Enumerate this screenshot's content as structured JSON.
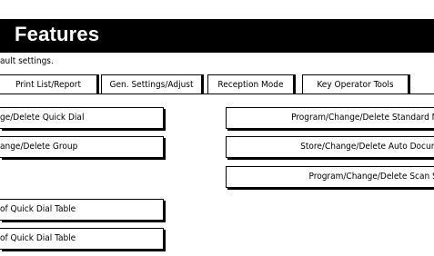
{
  "title": "Features",
  "subtitle": "ault settings.",
  "tabs": [
    {
      "label": "Print List/Report"
    },
    {
      "label": "Gen. Settings/Adjust"
    },
    {
      "label": "Reception Mode"
    },
    {
      "label": "Key Operator Tools"
    }
  ],
  "left_buttons": [
    {
      "label": "ge/Delete Quick Dial"
    },
    {
      "label": "ange/Delete Group"
    },
    {
      "label": "of Quick Dial Table"
    },
    {
      "label": "of Quick Dial Table"
    }
  ],
  "right_buttons": [
    {
      "label": "Program/Change/Delete Standard Me"
    },
    {
      "label": "Store/Change/Delete Auto Docume"
    },
    {
      "label": "Program/Change/Delete Scan Siz"
    }
  ]
}
